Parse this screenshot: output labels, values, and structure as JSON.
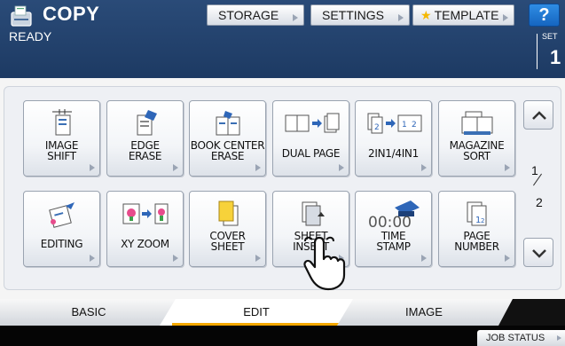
{
  "header": {
    "title": "COPY",
    "status": "READY",
    "set_label": "SET",
    "set_count": "1",
    "storage_label": "STORAGE",
    "settings_label": "SETTINGS",
    "template_label": "TEMPLATE",
    "help_label": "?"
  },
  "functions": [
    {
      "line1": "IMAGE",
      "line2": "SHIFT",
      "icon": "image-shift-icon"
    },
    {
      "line1": "EDGE",
      "line2": "ERASE",
      "icon": "edge-erase-icon"
    },
    {
      "line1": "BOOK CENTER",
      "line2": "ERASE",
      "icon": "book-center-erase-icon"
    },
    {
      "line1": "DUAL PAGE",
      "line2": "",
      "icon": "dual-page-icon"
    },
    {
      "line1": "2IN1/4IN1",
      "line2": "",
      "icon": "2in1-4in1-icon"
    },
    {
      "line1": "MAGAZINE",
      "line2": "SORT",
      "icon": "magazine-sort-icon"
    },
    {
      "line1": "EDITING",
      "line2": "",
      "icon": "editing-icon"
    },
    {
      "line1": "XY ZOOM",
      "line2": "",
      "icon": "xy-zoom-icon"
    },
    {
      "line1": "COVER",
      "line2": "SHEET",
      "icon": "cover-sheet-icon"
    },
    {
      "line1": "SHEET",
      "line2": "INSERT",
      "icon": "sheet-insert-icon"
    },
    {
      "line1": "TIME",
      "line2": "STAMP",
      "icon": "time-stamp-icon",
      "stamp_text": "00:00"
    },
    {
      "line1": "PAGE",
      "line2": "NUMBER",
      "icon": "page-number-icon"
    }
  ],
  "pager": {
    "current": "1",
    "total": "2"
  },
  "tabs": {
    "basic": "BASIC",
    "edit": "EDIT",
    "image": "IMAGE",
    "active": "EDIT"
  },
  "footer": {
    "job_status": "JOB STATUS"
  },
  "colors": {
    "header_bg": "#1d3a63",
    "accent_tab": "#f5a800",
    "help_bg": "#1565c0",
    "star": "#f5b800"
  }
}
